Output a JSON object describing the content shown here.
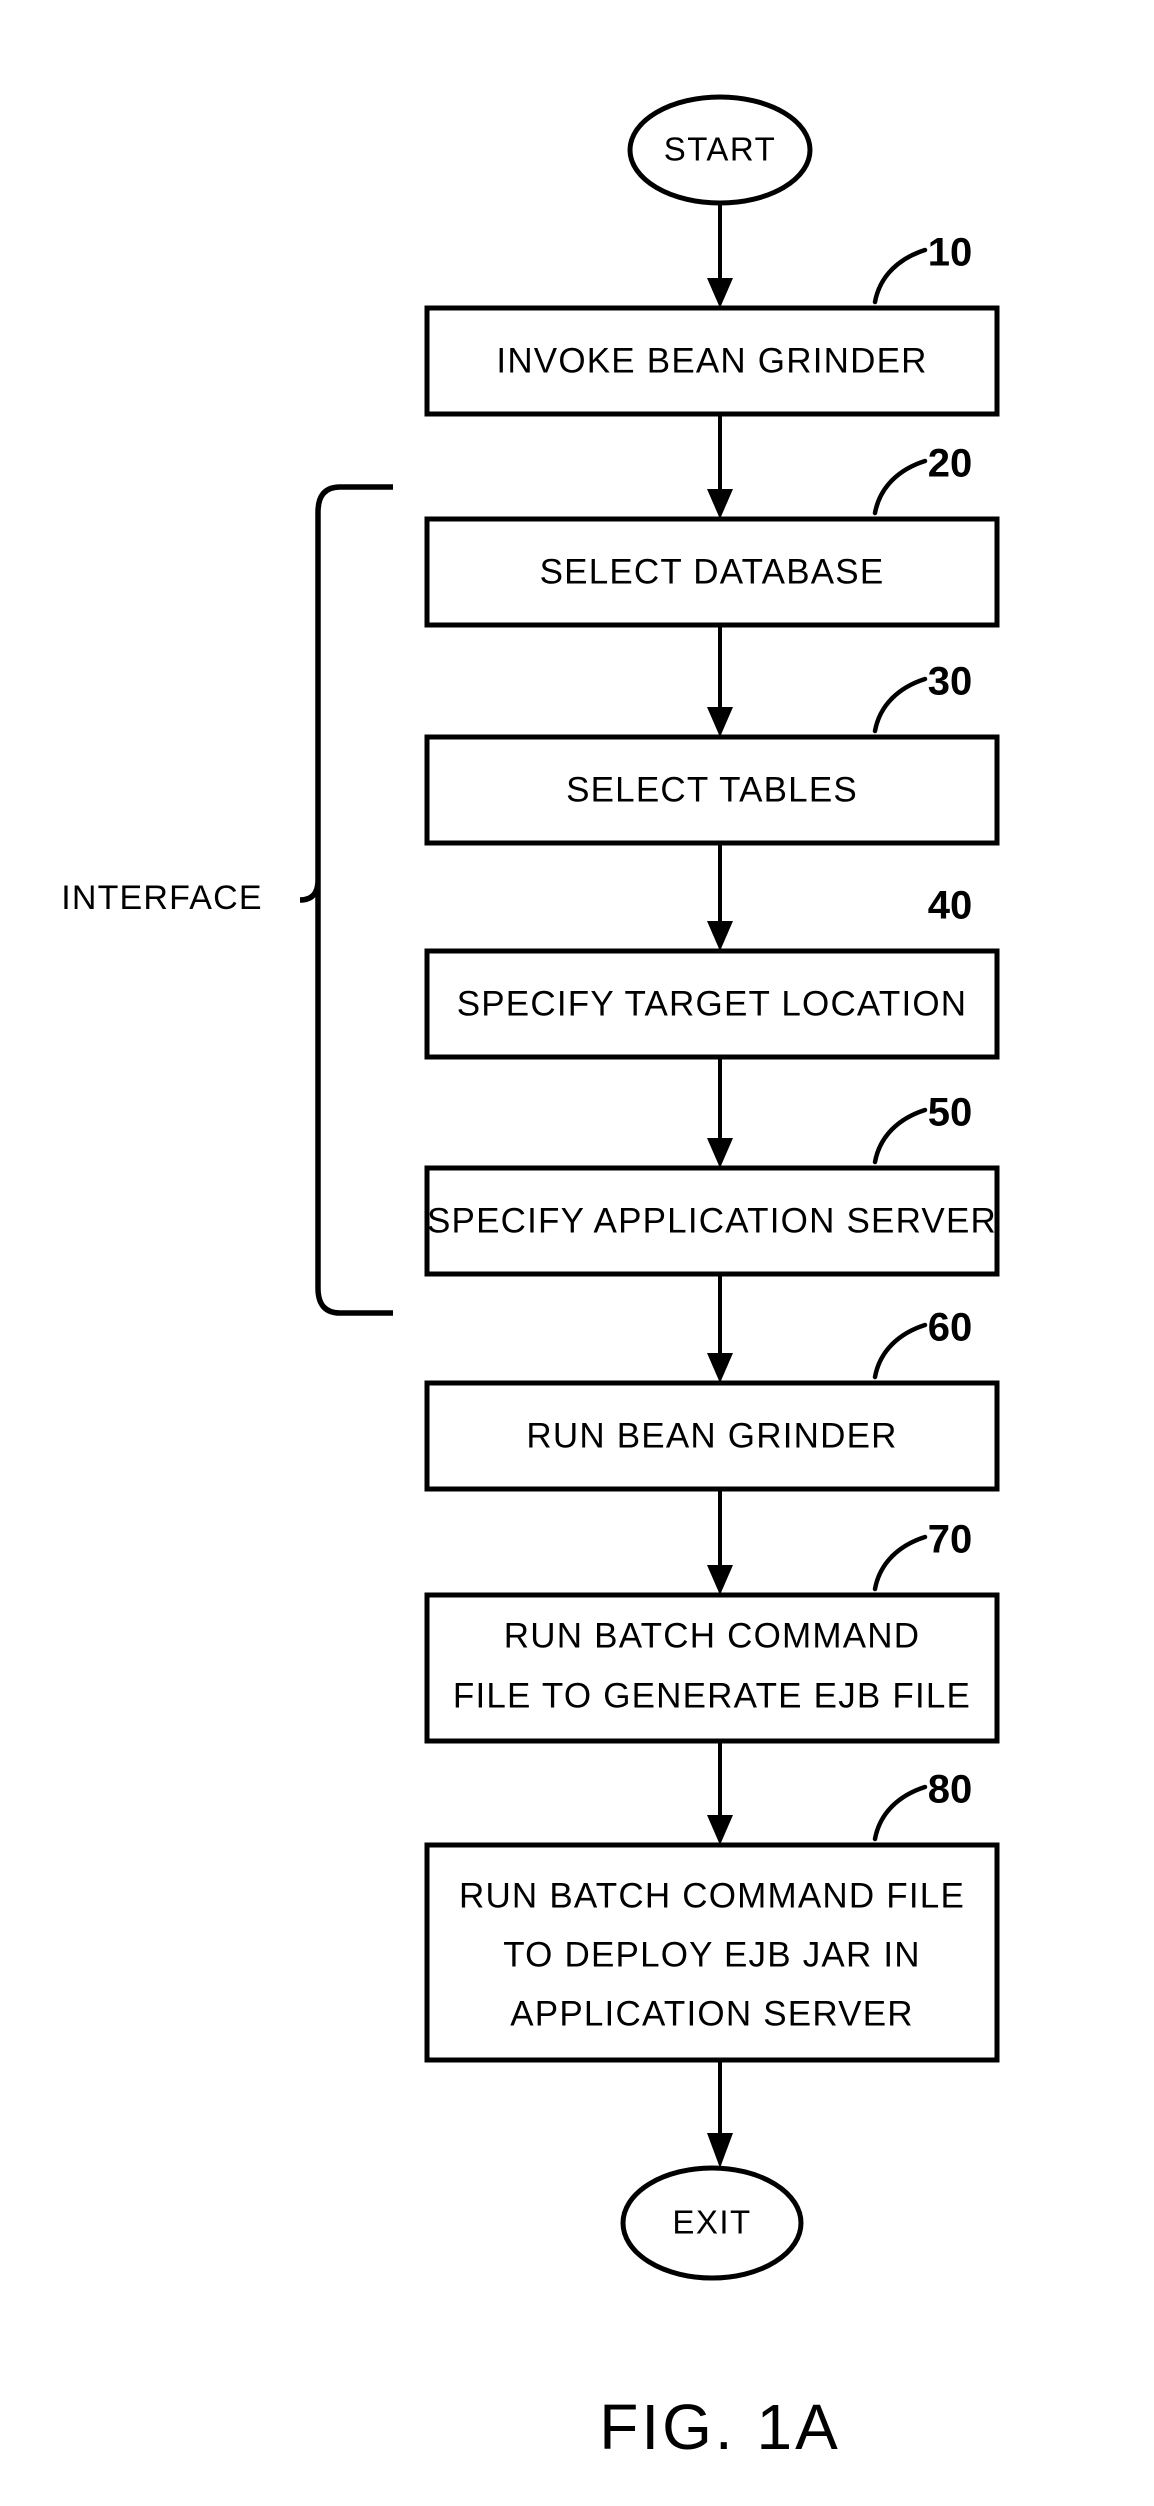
{
  "figure": {
    "caption": "FIG. 1A",
    "terminals": {
      "start": "START",
      "exit": "EXIT"
    },
    "group_label": "INTERFACE",
    "steps": [
      {
        "ref": "10",
        "lines": [
          "INVOKE  BEAN  GRINDER"
        ],
        "has_leader": true
      },
      {
        "ref": "20",
        "lines": [
          "SELECT  DATABASE"
        ],
        "has_leader": true
      },
      {
        "ref": "30",
        "lines": [
          "SELECT  TABLES"
        ],
        "has_leader": true
      },
      {
        "ref": "40",
        "lines": [
          "SPECIFY  TARGET  LOCATION"
        ],
        "has_leader": false
      },
      {
        "ref": "50",
        "lines": [
          "SPECIFY  APPLICATION  SERVER"
        ],
        "has_leader": true
      },
      {
        "ref": "60",
        "lines": [
          "RUN  BEAN  GRINDER"
        ],
        "has_leader": true
      },
      {
        "ref": "70",
        "lines": [
          "RUN  BATCH  COMMAND",
          "FILE TO  GENERATE  EJB  FILE"
        ],
        "has_leader": true
      },
      {
        "ref": "80",
        "lines": [
          "RUN  BATCH  COMMAND  FILE",
          "TO  DEPLOY  EJB  JAR  IN",
          "APPLICATION  SERVER"
        ],
        "has_leader": true
      }
    ],
    "colors": {
      "ink": "#000000",
      "paper": "#ffffff"
    }
  }
}
